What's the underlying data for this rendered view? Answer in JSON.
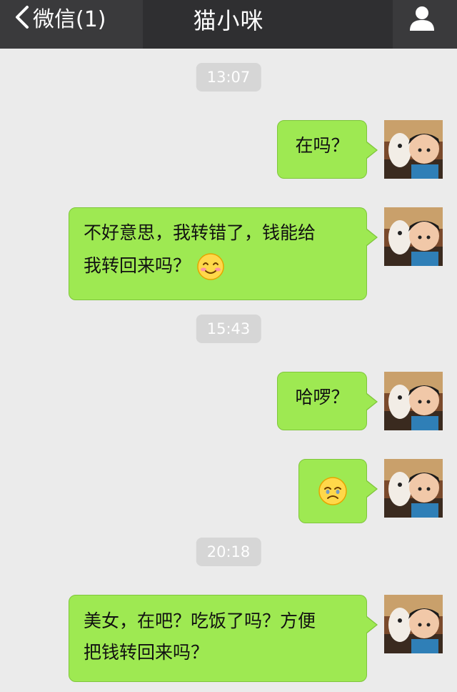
{
  "header": {
    "back_label": "微信(1)",
    "title": "猫小咪",
    "back_icon": "chevron-left-icon",
    "user_icon": "user-icon"
  },
  "colors": {
    "header_bg": "#2f2f31",
    "chat_bg": "#ebebeb",
    "bubble": "#9ee952",
    "timestamp_bg": "#d6d6d6"
  },
  "messages": [
    {
      "type": "time",
      "text": "13:07"
    },
    {
      "type": "sent",
      "text": "在吗？"
    },
    {
      "type": "sent",
      "text": "不好意思，我转错了，钱能给",
      "text2": "我转回来吗？",
      "emoji": "smile-blush-emoji"
    },
    {
      "type": "time",
      "text": "15:43"
    },
    {
      "type": "sent",
      "text": "哈啰？"
    },
    {
      "type": "sent",
      "emoji": "sad-emoji"
    },
    {
      "type": "time",
      "text": "20:18"
    },
    {
      "type": "sent",
      "text": "美女，在吧？吃饭了吗？方便",
      "text2": "把钱转回来吗？"
    }
  ]
}
